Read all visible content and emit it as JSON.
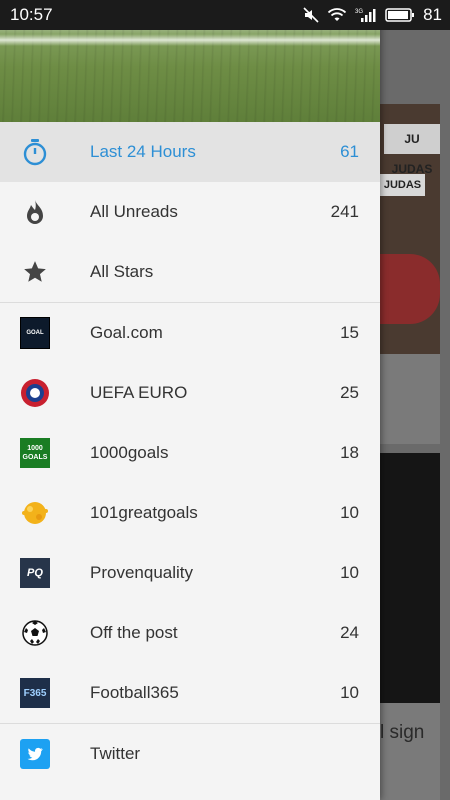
{
  "status_bar": {
    "time": "10:57",
    "battery": "81",
    "icons": [
      "mute-icon",
      "wifi-icon",
      "signal-3g-icon",
      "battery-icon"
    ]
  },
  "background": {
    "card1_banner": "JU JUDAS",
    "card1_banner2": "JUDAS",
    "card2_text": "l sign"
  },
  "drawer": {
    "accent_color": "#2d8fd5",
    "smart_items": [
      {
        "label": "Last 24 Hours",
        "count": "61",
        "icon": "stopwatch-icon",
        "active": true
      },
      {
        "label": "All Unreads",
        "count": "241",
        "icon": "flame-icon"
      },
      {
        "label": "All Stars",
        "count": "",
        "icon": "star-icon"
      }
    ],
    "feeds": [
      {
        "label": "Goal.com",
        "count": "15",
        "icon": "goal-com-logo-icon"
      },
      {
        "label": "UEFA EURO",
        "count": "25",
        "icon": "uefa-logo-icon"
      },
      {
        "label": "1000goals",
        "count": "18",
        "icon": "1000goals-logo-icon"
      },
      {
        "label": "101greatgoals",
        "count": "10",
        "icon": "101greatgoals-logo-icon"
      },
      {
        "label": "Provenquality",
        "count": "10",
        "icon": "provenquality-logo-icon"
      },
      {
        "label": "Off the post",
        "count": "24",
        "icon": "soccer-ball-icon"
      },
      {
        "label": "Football365",
        "count": "10",
        "icon": "football365-logo-icon"
      }
    ],
    "services": [
      {
        "label": "Twitter",
        "icon": "twitter-icon"
      }
    ],
    "logo_text": {
      "goal": "GOAL",
      "uefa": "UEFA",
      "thousand": "1000",
      "thousand2": "GOALS",
      "pq": "PQ",
      "f365": "F365"
    }
  }
}
